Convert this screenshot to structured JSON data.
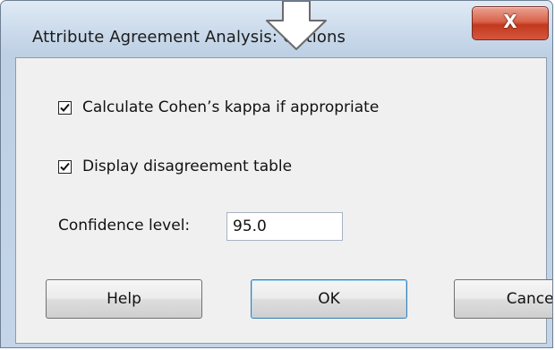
{
  "window": {
    "title": "Attribute Agreement Analysis: Options",
    "close_symbol": "X"
  },
  "options": {
    "cohens_kappa": {
      "label": "Calculate Cohen’s kappa if appropriate",
      "checked": true
    },
    "disagreement_table": {
      "label": "Display disagreement table",
      "checked": true
    }
  },
  "confidence": {
    "label": "Confidence level:",
    "value": "95.0"
  },
  "buttons": {
    "help": "Help",
    "ok": "OK",
    "cancel": "Cancel"
  },
  "icons": {
    "overlay_arrow": "down-arrow-icon",
    "close": "close-icon",
    "checkmark": "checkmark-icon"
  },
  "colors": {
    "close_button": "#c9442a",
    "titlebar": "#c9d9ea",
    "client_area": "#f0f0f0"
  }
}
